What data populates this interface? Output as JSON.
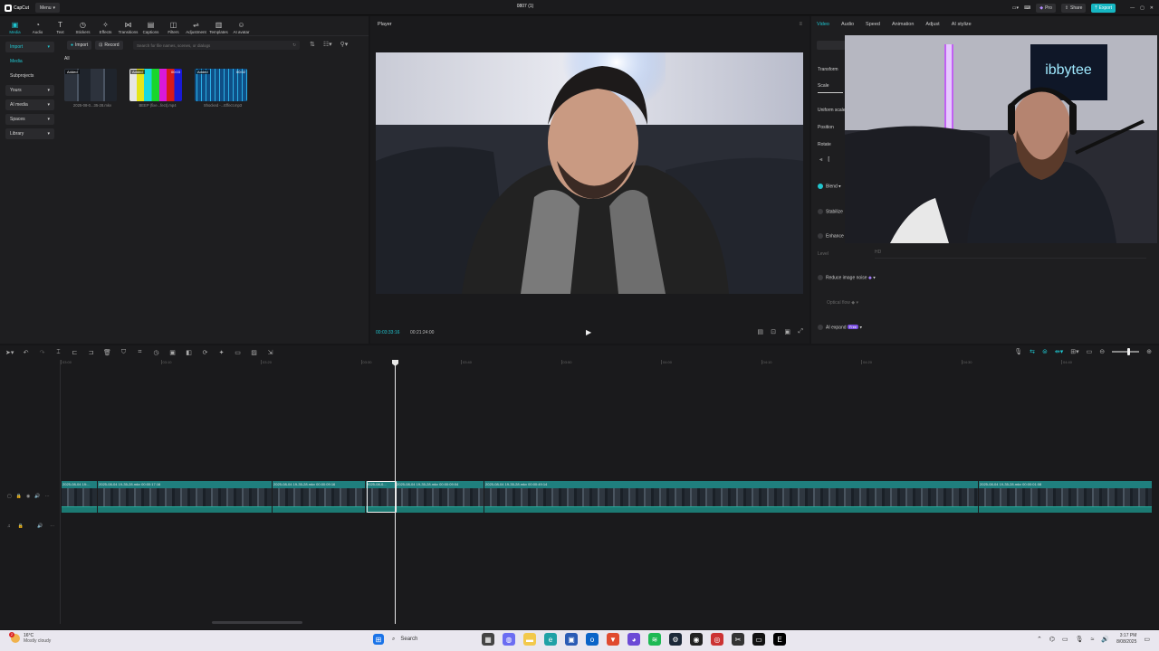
{
  "titlebar": {
    "app_name": "CapCut",
    "menu_label": "Menu",
    "project_title": "0807 (1)",
    "pro_label": "Pro",
    "share_label": "Share",
    "export_label": "Export"
  },
  "media_toolbar": [
    {
      "label": "Media",
      "icon": "media-icon"
    },
    {
      "label": "Audio",
      "icon": "audio-icon"
    },
    {
      "label": "Text",
      "icon": "text-icon"
    },
    {
      "label": "Stickers",
      "icon": "stickers-icon"
    },
    {
      "label": "Effects",
      "icon": "effects-icon"
    },
    {
      "label": "Transitions",
      "icon": "transitions-icon"
    },
    {
      "label": "Captions",
      "icon": "captions-icon"
    },
    {
      "label": "Filters",
      "icon": "filters-icon"
    },
    {
      "label": "Adjustment",
      "icon": "adjustment-icon"
    },
    {
      "label": "Templates",
      "icon": "templates-icon"
    },
    {
      "label": "AI avatar",
      "icon": "ai-avatar-icon"
    }
  ],
  "media_sidebar": [
    "Import",
    "Media",
    "Subprojects",
    "Yours",
    "AI media",
    "Spaces",
    "Library"
  ],
  "media_actions": {
    "import": "Import",
    "record": "Record"
  },
  "search": {
    "placeholder": "Search for file names, scenes, or dialogs"
  },
  "filter_all": "All",
  "media_items": [
    {
      "tag": "Added",
      "duration": "",
      "caption": "2025-08-0...35-28.mkv"
    },
    {
      "tag": "Added",
      "duration": "00:03",
      "caption": "BEEP (fixe...fect).mp4"
    },
    {
      "tag": "Added",
      "duration": "00:02",
      "caption": "Shocked -...Effect.mp3"
    }
  ],
  "player": {
    "title": "Player",
    "current_time": "00:03:33:16",
    "total_time": "00:21:24:00"
  },
  "props": {
    "tabs": [
      "Video",
      "Audio",
      "Speed",
      "Animation",
      "Adjust",
      "AI stylize"
    ],
    "transform": "Transform",
    "scale": "Scale",
    "uniform_scale": "Uniform scale",
    "position": "Position",
    "rotate": "Rotate",
    "blend": "Blend",
    "stabilize": "Stabilize",
    "enhance": "Enhance",
    "level": "Level",
    "level_value": "HD",
    "reduce_noise": "Reduce image noise",
    "optical_flow": "Optical flow",
    "ai_expand": "AI expand",
    "ai_expand_badge": "Free"
  },
  "webcam": {
    "sign_text": "ibbytee"
  },
  "timeline": {
    "ruler_ticks": [
      "03:00",
      "03:10",
      "03:20",
      "03:30",
      "03:40",
      "03:50",
      "04:00",
      "04:10",
      "04:20",
      "04:30",
      "04:40"
    ],
    "clips": [
      {
        "label": "2025-08-04 19:...",
        "width": 40
      },
      {
        "label": "2025-08-04 19-35-28.mkv  00:00:17:16",
        "width": 193
      },
      {
        "label": "2025-08-04 19-35-28.mkv  00:00:09:16",
        "width": 103
      },
      {
        "label": "2025-08-0...",
        "width": 33
      },
      {
        "label": "2025-08-04 19-35-28.mkv  00:00:09:04",
        "width": 98
      },
      {
        "label": "2025-08-04 19-35-28.mkv  00:00:49:14",
        "width": 546
      },
      {
        "label": "2025-08-04 19-35-28.mkv  00:00:01:08",
        "width": 192
      }
    ]
  },
  "taskbar": {
    "weather_temp": "16°C",
    "weather_desc": "Mostly cloudy",
    "search_label": "Search",
    "time": "3:17 PM",
    "date": "8/08/2025"
  },
  "colors": {
    "accent": "#1ec5cf",
    "clip_header": "#1f7f7e",
    "export": "#16b6c2"
  }
}
